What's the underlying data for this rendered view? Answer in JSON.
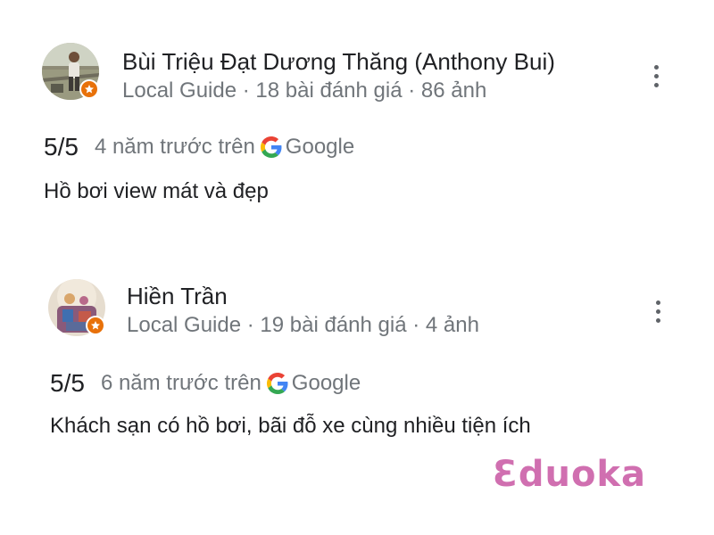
{
  "reviews": [
    {
      "author_name": "Bùi Triệu Đạt Dương Thăng (Anthony Bui)",
      "author_meta": "Local Guide · 18 bài đánh giá · 86 ảnh",
      "rating": "5/5",
      "time_ago": "4 năm trước trên",
      "source": "Google",
      "text": "Hồ bơi view mát và đẹp",
      "avatar_icon": "profile-photo-icon",
      "badge_icon": "local-guide-star-icon"
    },
    {
      "author_name": "Hiền Trần",
      "author_meta": "Local Guide · 19 bài đánh giá · 4 ảnh",
      "rating": "5/5",
      "time_ago": "6 năm trước trên",
      "source": "Google",
      "text": "Khách sạn có hồ bơi, bãi đỗ xe cùng nhiều tiện ích",
      "avatar_icon": "profile-photo-icon",
      "badge_icon": "local-guide-star-icon"
    }
  ],
  "watermark": "Ɛduoka",
  "colors": {
    "text_primary": "#202124",
    "text_secondary": "#70757a",
    "badge_orange": "#e8710a",
    "watermark_pink": "#d06fb0",
    "google_blue": "#4285F4",
    "google_red": "#EA4335",
    "google_yellow": "#FBBC05",
    "google_green": "#34A853"
  }
}
